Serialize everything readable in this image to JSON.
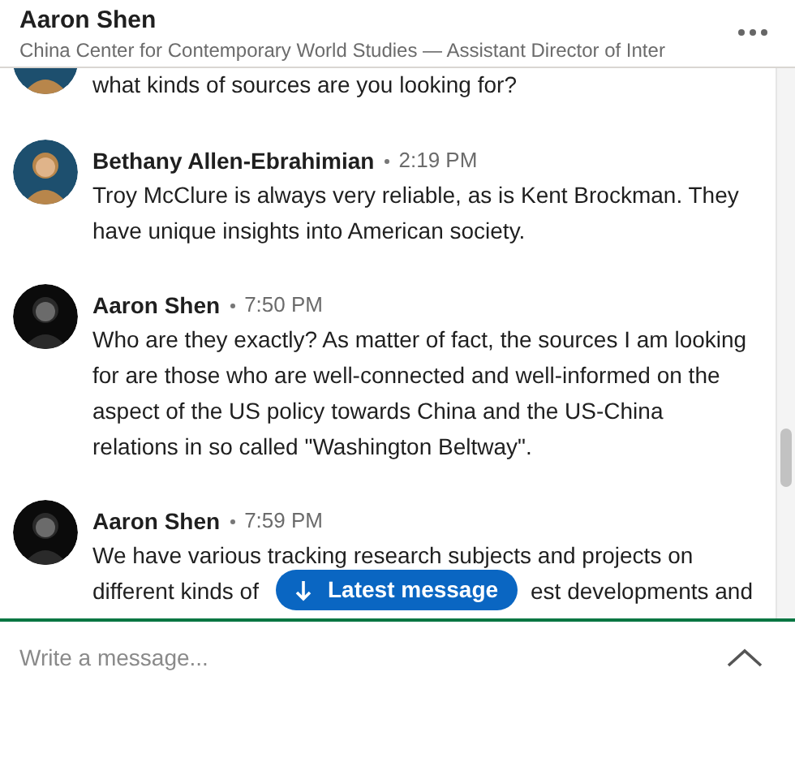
{
  "header": {
    "name": "Aaron Shen",
    "subtitle": "China Center for Contemporary World Studies — Assistant Director of Inter"
  },
  "messages": [
    {
      "kind": "continuation",
      "body": "what kinds of sources are you looking for?"
    },
    {
      "kind": "message",
      "sender": "Bethany Allen-Ebrahimian",
      "time": "2:19 PM",
      "body": "Troy McClure is always very reliable, as is Kent Brockman. They have unique insights into American society."
    },
    {
      "kind": "message",
      "sender": "Aaron Shen",
      "time": "7:50 PM",
      "body": "Who are they exactly? As matter of fact, the sources I am looking for are those who are well-connected and well-informed on the aspect of the US policy towards China and the US-China relations in so called \"Washington Beltway\"."
    },
    {
      "kind": "covered",
      "sender": "Aaron Shen",
      "time": "7:59 PM",
      "lines": [
        [
          "We have various tracking research subjects and projects on"
        ],
        [
          "different kinds of",
          "est developments and"
        ]
      ]
    }
  ],
  "latest_button": {
    "label": "Latest message"
  },
  "composer": {
    "placeholder": "Write a message..."
  }
}
